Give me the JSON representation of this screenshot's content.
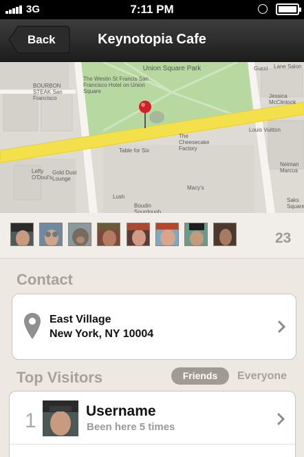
{
  "status_bar": {
    "network": "3G",
    "time": "7:11 PM"
  },
  "nav": {
    "back_label": "Back",
    "title": "Keynotopia Cafe"
  },
  "map": {
    "labels": {
      "union_square_park": "Union Square Park",
      "westin": "The Westin St Francis San Francisco Hotel on Union Square",
      "bourbon": "BOURBON STEAK San Francisco",
      "gucci": "Gucci",
      "lane_salon": "Lane Salon",
      "jessica": "Jessica McClintock",
      "louis": "Louis Vuitton",
      "table_for_six": "Table for Six",
      "cheesecake": "The Cheesecake Factory",
      "neiman": "Neiman Marcus",
      "lefty": "Lefty O'Doul's",
      "gold_dust": "Gold Dust Lounge",
      "macys": "Macy's",
      "lush": "Lush",
      "boudin": "Boudin Sourdough",
      "saks": "Saks Square"
    }
  },
  "avatars": {
    "count": "23"
  },
  "contact": {
    "heading": "Contact",
    "line1": "East Village",
    "line2": "New York, NY 10004",
    "icon": "location-pin-icon"
  },
  "top_visitors": {
    "heading": "Top Visitors",
    "filter_selected": "Friends",
    "filter_other": "Everyone",
    "items": [
      {
        "rank": "1",
        "name": "Username",
        "subtitle": "Been here 5 times"
      }
    ]
  },
  "colors": {
    "nav_bg": "#2a2a2a",
    "page_bg": "#ede8e2",
    "pin": "#d0202a",
    "road": "#f5e142"
  }
}
